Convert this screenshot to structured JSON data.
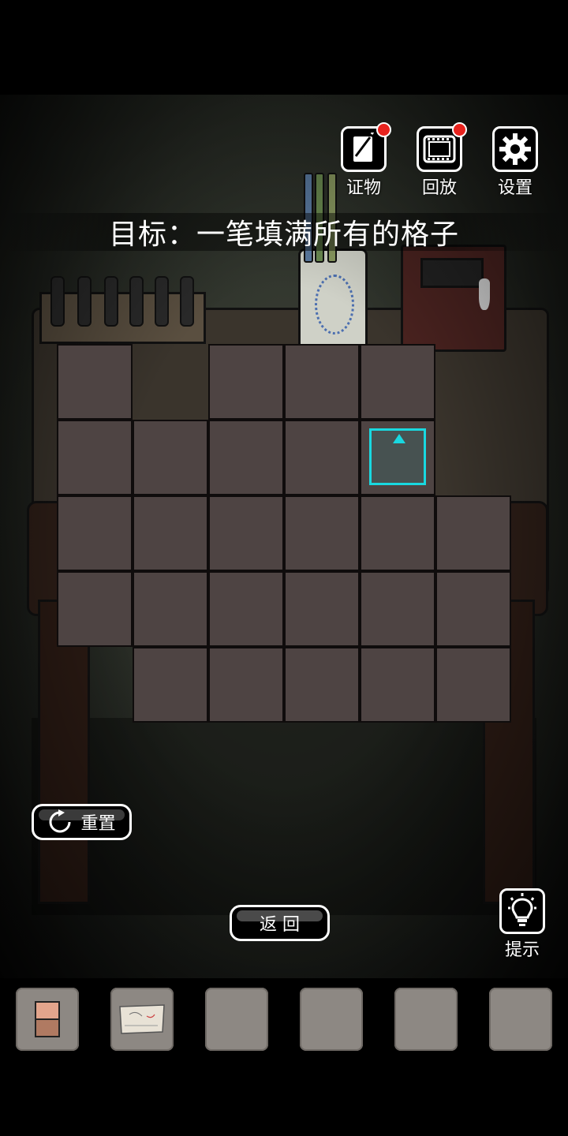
{
  "toolbar": {
    "evidence_label": "证物",
    "replay_label": "回放",
    "settings_label": "设置"
  },
  "goal": {
    "text": "目标：一笔填满所有的格子"
  },
  "puzzle": {
    "rows": 5,
    "cols": 6,
    "cells": [
      [
        1,
        0,
        1,
        1,
        1,
        0
      ],
      [
        1,
        1,
        1,
        1,
        1,
        0
      ],
      [
        1,
        1,
        1,
        1,
        1,
        1
      ],
      [
        1,
        1,
        1,
        1,
        1,
        1
      ],
      [
        0,
        1,
        1,
        1,
        1,
        1
      ]
    ],
    "cursor": {
      "row": 1,
      "col": 4,
      "direction": "up"
    }
  },
  "controls": {
    "reset_label": "重置",
    "back_label": "返 回",
    "hint_label": "提示"
  },
  "inventory": {
    "slots": [
      {
        "item": "torn-photo-piece"
      },
      {
        "item": "paper-note"
      },
      {
        "item": ""
      },
      {
        "item": ""
      },
      {
        "item": ""
      },
      {
        "item": ""
      }
    ]
  },
  "colors": {
    "cell": "#4e4443",
    "cursor": "#19d8e0",
    "badge": "#e8231e",
    "slot": "#8d8883"
  }
}
